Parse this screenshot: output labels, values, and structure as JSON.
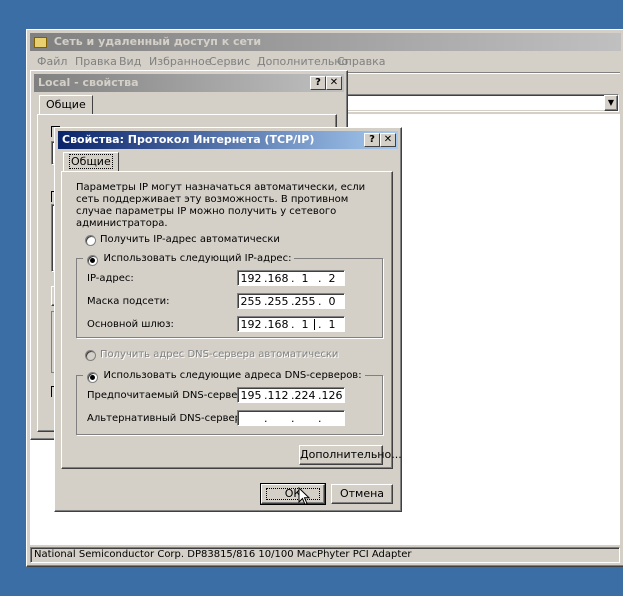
{
  "main_window": {
    "title": "Сеть и удаленный доступ к сети",
    "menu": [
      "Файл",
      "Правка",
      "Вид",
      "Избранное",
      "Сервис",
      "Дополнительно",
      "Справка"
    ],
    "status_bar": "National Semiconductor Corp. DP83815/816 10/100 MacPhyter PCI Adapter"
  },
  "local_props": {
    "title": "Local - свойства",
    "tab": "Общие",
    "help": "?",
    "close": "✕"
  },
  "tcpip": {
    "title": "Свойства: Протокол Интернета (TCP/IP)",
    "help": "?",
    "close": "✕",
    "tab": "Общие",
    "description": "Параметры IP могут назначаться автоматически, если сеть поддерживает эту возможность. В противном случае параметры IP можно получить у сетевого администратора.",
    "radio_auto_ip": "Получить IP-адрес автоматически",
    "radio_manual_ip": "Использовать следующий IP-адрес:",
    "ip_label": "IP-адрес:",
    "mask_label": "Маска подсети:",
    "gateway_label": "Основной шлюз:",
    "ip": [
      "192",
      "168",
      "1",
      "2"
    ],
    "mask": [
      "255",
      "255",
      "255",
      "0"
    ],
    "gateway": [
      "192",
      "168",
      "1",
      "1"
    ],
    "radio_auto_dns": "Получить адрес DNS-сервера автоматически",
    "radio_manual_dns": "Использовать следующие адреса DNS-серверов:",
    "dns1_label": "Предпочитаемый DNS-сервер:",
    "dns2_label": "Альтернативный DNS-сервер:",
    "dns1": [
      "195",
      "112",
      "224",
      "126"
    ],
    "dns2": [
      "",
      "",
      "",
      ""
    ],
    "advanced_button": "Дополнительно...",
    "ok_button": "ОК",
    "cancel_button": "Отмена"
  }
}
